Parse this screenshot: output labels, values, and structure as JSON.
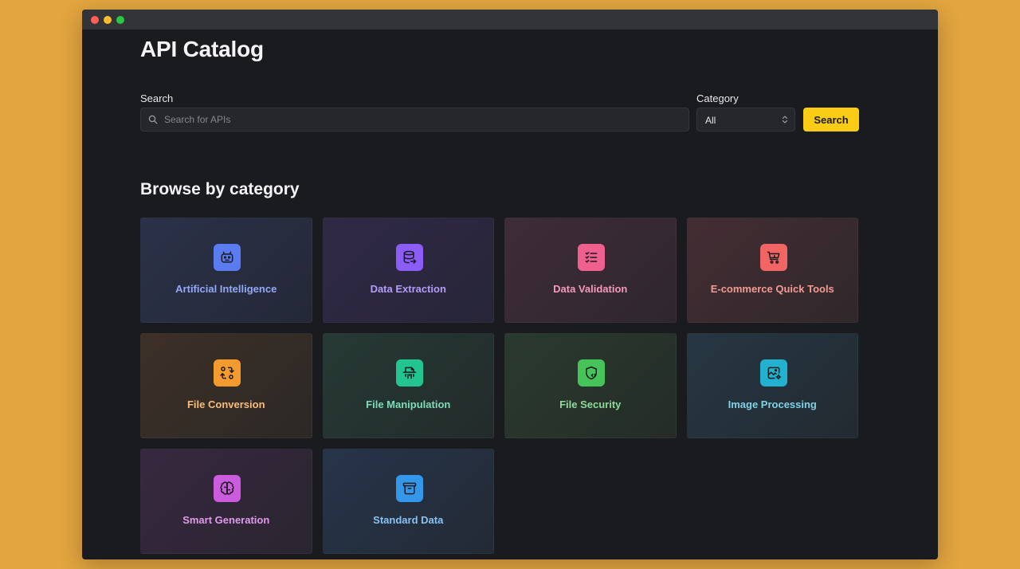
{
  "window": {
    "controls": [
      "close",
      "minimize",
      "maximize"
    ]
  },
  "page": {
    "title": "API Catalog"
  },
  "search": {
    "label": "Search",
    "placeholder": "Search for APIs",
    "value": "",
    "icon": "search-icon"
  },
  "category_filter": {
    "label": "Category",
    "selected": "All"
  },
  "search_button": {
    "label": "Search",
    "color": "#facc15"
  },
  "browse": {
    "title": "Browse by category",
    "categories": [
      {
        "label": "Artificial Intelligence",
        "icon": "robot-icon",
        "color": "#5b7cf0"
      },
      {
        "label": "Data Extraction",
        "icon": "database-export-icon",
        "color": "#8b5cf6"
      },
      {
        "label": "Data Validation",
        "icon": "checklist-icon",
        "color": "#f0608e"
      },
      {
        "label": "E-commerce Quick Tools",
        "icon": "shopping-cart-icon",
        "color": "#f26565"
      },
      {
        "label": "File Conversion",
        "icon": "transform-icon",
        "color": "#f49a2f"
      },
      {
        "label": "File Manipulation",
        "icon": "file-shredder-icon",
        "color": "#22c58f"
      },
      {
        "label": "File Security",
        "icon": "shield-code-icon",
        "color": "#46c45a"
      },
      {
        "label": "Image Processing",
        "icon": "photo-cog-icon",
        "color": "#22b2cf"
      },
      {
        "label": "Smart Generation",
        "icon": "brain-icon",
        "color": "#cc5bde"
      },
      {
        "label": "Standard Data",
        "icon": "archive-box-icon",
        "color": "#3498ea"
      }
    ]
  }
}
